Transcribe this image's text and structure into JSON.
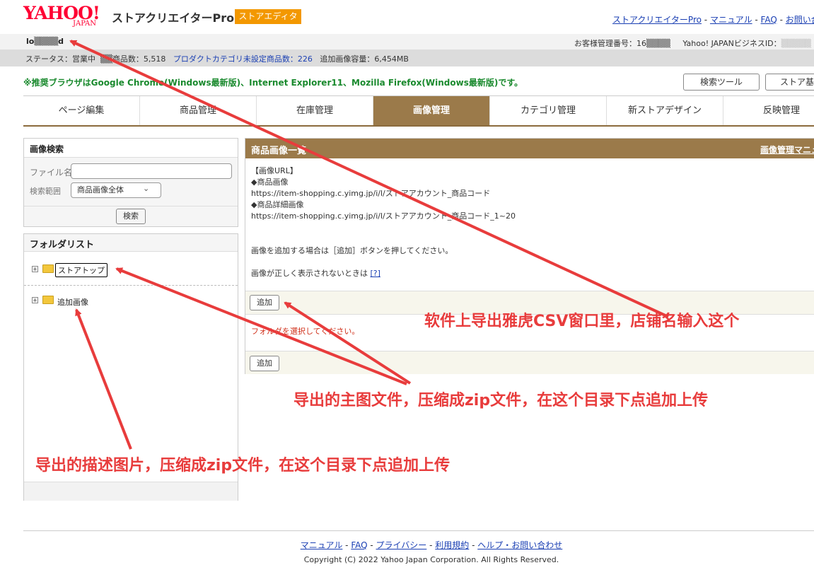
{
  "header": {
    "logo_main": "YAHOO!",
    "logo_sub": "JAPAN",
    "app_name": "ストアクリエイターPro",
    "editor_badge": "ストアエディタ",
    "top_links": [
      "ストアクリエイターPro",
      "マニュアル",
      "FAQ",
      "お問い合わせ"
    ],
    "account_id": "lo▒▒▒▒d",
    "customer_label": "お客様管理番号：16▒▒▒▒",
    "business_label": "Yahoo! JAPANビジネスID："
  },
  "status": {
    "store_status": "ステータス：営業中",
    "public_items": "▒▒商品数：5,518",
    "unset_category": "プロダクトカテゴリ未設定商品数：226",
    "added_capacity": "追加画像容量：6,454MB"
  },
  "browser_note": "※推奨ブラウザはGoogle Chrome(Windows最新版)、Internet Explorer11、Mozilla Firefox(Windows最新版)です。",
  "tools": {
    "search_tool": "検索ツール",
    "store_basic": "ストア基本"
  },
  "nav_tabs": [
    "ページ編集",
    "商品管理",
    "在庫管理",
    "画像管理",
    "カテゴリ管理",
    "新ストアデザイン",
    "反映管理"
  ],
  "search_panel": {
    "title": "画像検索",
    "file_label": "ファイル名",
    "file_value": "",
    "range_label": "検索範囲",
    "range_value": "商品画像全体",
    "search_button": "検索"
  },
  "folder_panel": {
    "title": "フォルダリスト",
    "folders": [
      "ストアトップ",
      "追加画像"
    ]
  },
  "list_panel": {
    "title": "商品画像一覧",
    "manual_link": "画像管理マニュアル",
    "info_lines": [
      "【画像URL】",
      "◆商品画像",
      "https://item-shopping.c.yimg.jp/i/l/ストアアカウント_商品コード",
      "◆商品詳細画像",
      "https://item-shopping.c.yimg.jp/i/l/ストアアカウント_商品コード_1~20"
    ],
    "add_note": "画像を追加する場合は［追加］ボタンを押してください。",
    "broken_note": "画像が正しく表示されないときは",
    "broken_link": "[?]",
    "add_button": "追加",
    "folder_prompt": "フォルダを選択してください。"
  },
  "footer": {
    "links": [
      "マニュアル",
      "FAQ",
      "プライバシー",
      "利用規約",
      "ヘルプ・お問い合わせ"
    ],
    "copyright": "Copyright (C) 2022 Yahoo Japan Corporation. All Rights Reserved."
  },
  "annotations": {
    "store_name": "软件上导出雅虎CSV窗口里，店铺名输入这个",
    "main_image": "导出的主图文件，压缩成zip文件，在这个目录下点追加上传",
    "detail_image": "导出的描述图片，压缩成zip文件，在这个目录下点追加上传",
    "arrow_color": "#e83c3c"
  },
  "colors": {
    "brand_red": "#ff0033",
    "badge_orange": "#f39800",
    "nav_active": "#9b7a4a",
    "note_green": "#1a8a2e"
  }
}
